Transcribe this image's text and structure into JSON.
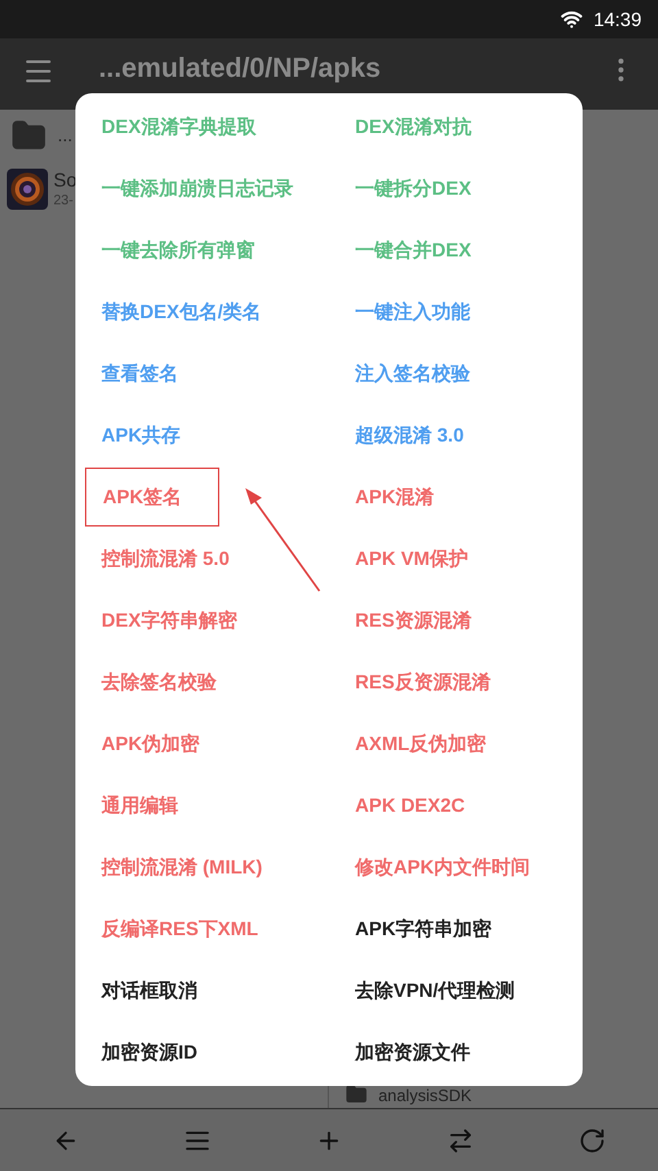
{
  "status_bar": {
    "time": "14:39"
  },
  "toolbar": {
    "title": "...emulated/0/NP/apks"
  },
  "left_pane": {
    "rows": [
      {
        "kind": "folder",
        "name": "..."
      },
      {
        "kind": "file",
        "name": "So",
        "detail": "23-"
      }
    ]
  },
  "right_pane": {
    "rows": [
      {
        "kind": "folder",
        "name": "analysisSDK"
      }
    ]
  },
  "dialog": {
    "items": [
      {
        "label": "DEX混淆字典提取",
        "color": "#5cbf84",
        "highlighted": false
      },
      {
        "label": "DEX混淆对抗",
        "color": "#5cbf84",
        "highlighted": false
      },
      {
        "label": "一键添加崩溃日志记录",
        "color": "#5cbf84",
        "highlighted": false
      },
      {
        "label": "一键拆分DEX",
        "color": "#5cbf84",
        "highlighted": false
      },
      {
        "label": "一键去除所有弹窗",
        "color": "#5cbf84",
        "highlighted": false
      },
      {
        "label": "一键合并DEX",
        "color": "#5cbf84",
        "highlighted": false
      },
      {
        "label": "替换DEX包名/类名",
        "color": "#4f9ef0",
        "highlighted": false
      },
      {
        "label": "一键注入功能",
        "color": "#4f9ef0",
        "highlighted": false
      },
      {
        "label": "查看签名",
        "color": "#4f9ef0",
        "highlighted": false
      },
      {
        "label": "注入签名校验",
        "color": "#4f9ef0",
        "highlighted": false
      },
      {
        "label": "APK共存",
        "color": "#4f9ef0",
        "highlighted": false
      },
      {
        "label": "超级混淆 3.0",
        "color": "#4f9ef0",
        "highlighted": false
      },
      {
        "label": "APK签名",
        "color": "#f06b6b",
        "highlighted": true
      },
      {
        "label": "APK混淆",
        "color": "#f06b6b",
        "highlighted": false
      },
      {
        "label": "控制流混淆 5.0",
        "color": "#f06b6b",
        "highlighted": false
      },
      {
        "label": "APK VM保护",
        "color": "#f06b6b",
        "highlighted": false
      },
      {
        "label": "DEX字符串解密",
        "color": "#f06b6b",
        "highlighted": false
      },
      {
        "label": "RES资源混淆",
        "color": "#f06b6b",
        "highlighted": false
      },
      {
        "label": "去除签名校验",
        "color": "#f06b6b",
        "highlighted": false
      },
      {
        "label": "RES反资源混淆",
        "color": "#f06b6b",
        "highlighted": false
      },
      {
        "label": "APK伪加密",
        "color": "#f06b6b",
        "highlighted": false
      },
      {
        "label": "AXML反伪加密",
        "color": "#f06b6b",
        "highlighted": false
      },
      {
        "label": "通用编辑",
        "color": "#f06b6b",
        "highlighted": false
      },
      {
        "label": "APK DEX2C",
        "color": "#f06b6b",
        "highlighted": false
      },
      {
        "label": "控制流混淆 (MILK)",
        "color": "#f06b6b",
        "highlighted": false
      },
      {
        "label": "修改APK内文件时间",
        "color": "#f06b6b",
        "highlighted": false
      },
      {
        "label": "反编译RES下XML",
        "color": "#f06b6b",
        "highlighted": false
      },
      {
        "label": "APK字符串加密",
        "color": "#222222",
        "highlighted": false
      },
      {
        "label": "对话框取消",
        "color": "#222222",
        "highlighted": false
      },
      {
        "label": "去除VPN/代理检测",
        "color": "#222222",
        "highlighted": false
      },
      {
        "label": "加密资源ID",
        "color": "#222222",
        "highlighted": false
      },
      {
        "label": "加密资源文件",
        "color": "#222222",
        "highlighted": false
      }
    ]
  }
}
